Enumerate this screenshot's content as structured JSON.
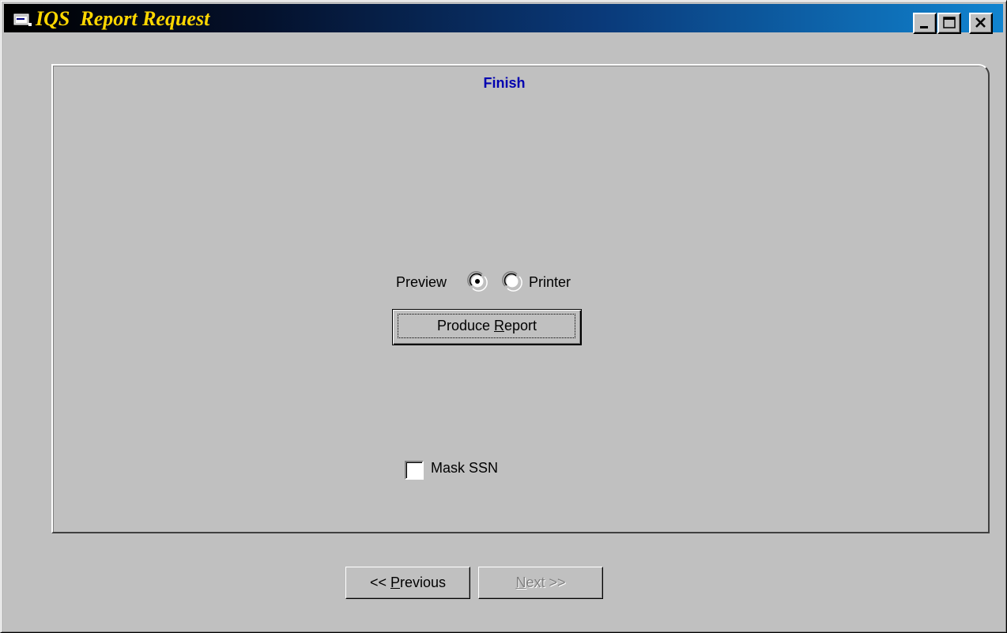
{
  "window": {
    "title": "IQS  Report Request",
    "controls": {
      "minimize_icon": "minimize-icon",
      "maximize_icon": "maximize-icon",
      "close_icon": "close-icon"
    }
  },
  "step": {
    "title": "Finish"
  },
  "output": {
    "preview_label": "Preview",
    "printer_label": "Printer",
    "selected": "Preview"
  },
  "produce_button": {
    "label_before": "Produce ",
    "label_accel": "R",
    "label_after": "eport"
  },
  "mask_ssn": {
    "label": "Mask SSN",
    "checked": false
  },
  "navigation": {
    "previous_prefix": "<< ",
    "previous_accel": "P",
    "previous_rest": "revious",
    "next_accel": "N",
    "next_rest": "ext >>",
    "next_enabled": false
  },
  "colors": {
    "title_text": "#ffd700",
    "step_title": "#0000b0",
    "face": "#c0c0c0"
  }
}
